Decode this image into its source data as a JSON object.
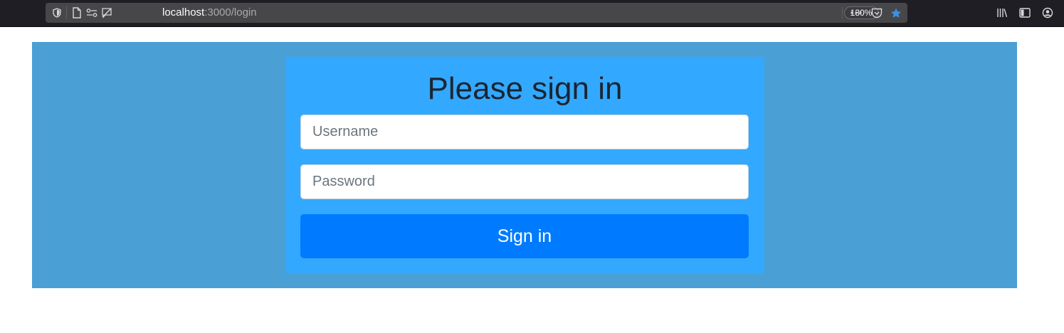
{
  "browser": {
    "url_host": "localhost",
    "url_path": ":3000/login",
    "zoom": "130%",
    "icons": [
      "shield-icon",
      "page-icon",
      "permissions-icon",
      "tracking-icon",
      "more-icon",
      "pocket-icon",
      "bookmark-star-icon",
      "library-icon",
      "sidebar-icon",
      "account-icon"
    ],
    "accent_color": "#3d8fe6"
  },
  "login": {
    "title": "Please sign in",
    "username_placeholder": "Username",
    "username_value": "",
    "password_placeholder": "Password",
    "password_value": "",
    "submit_label": "Sign in"
  },
  "colors": {
    "panel": "#4aa0d5",
    "card": "#33a8ff",
    "button": "#007bff"
  }
}
